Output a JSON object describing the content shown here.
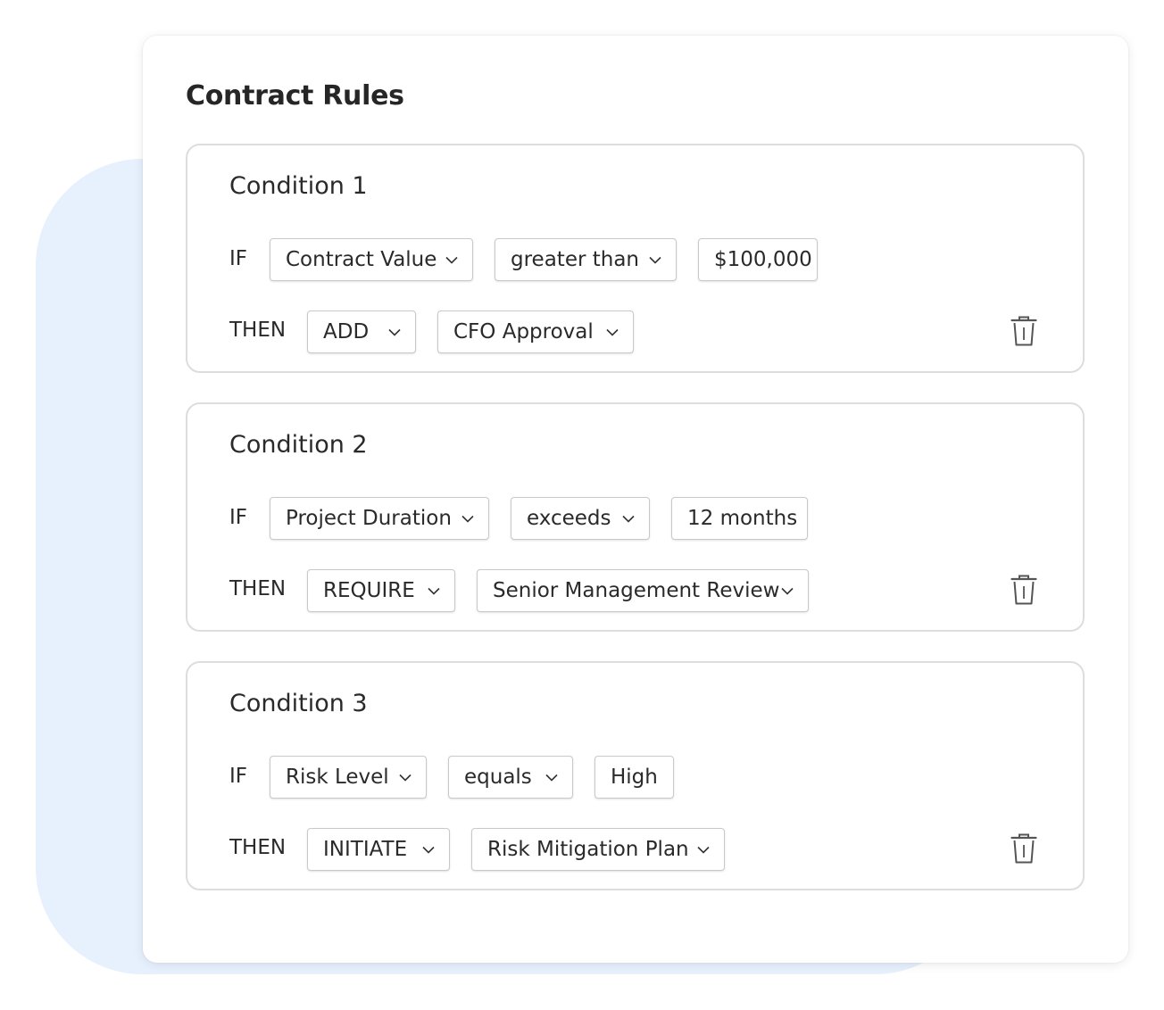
{
  "page": {
    "title": "Contract Rules"
  },
  "labels": {
    "if": "IF",
    "then": "THEN"
  },
  "conditions": [
    {
      "title": "Condition 1",
      "field": "Contract Value",
      "operator": "greater than",
      "value": "$100,000",
      "action": "ADD",
      "target": "CFO Approval"
    },
    {
      "title": "Condition 2",
      "field": "Project Duration",
      "operator": "exceeds",
      "value": "12 months",
      "action": "REQUIRE",
      "target": "Senior Management Review"
    },
    {
      "title": "Condition 3",
      "field": "Risk Level",
      "operator": "equals",
      "value": "High",
      "action": "INITIATE",
      "target": "Risk Mitigation Plan"
    }
  ],
  "icons": {
    "dropdown": "chevron-down-icon",
    "delete": "trash-icon"
  },
  "colors": {
    "background_accent": "#e7f0fd",
    "border": "#dddddd",
    "text": "#262626"
  }
}
